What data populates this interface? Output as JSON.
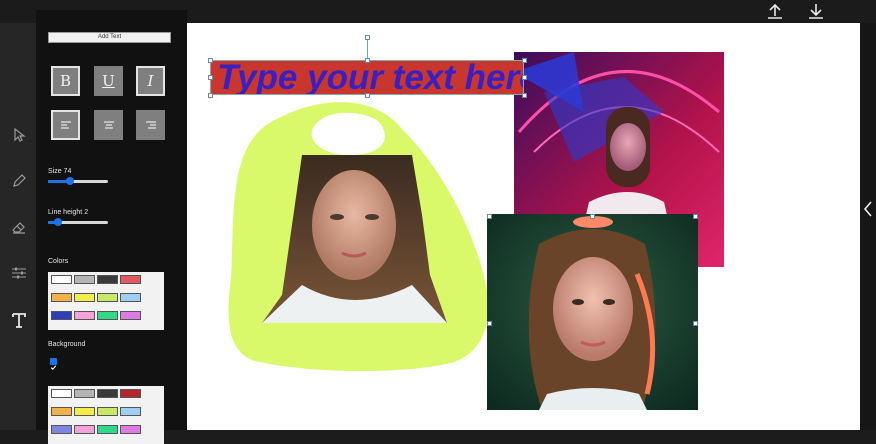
{
  "toolbar": {
    "upload_icon": "upload-icon",
    "download_icon": "download-icon"
  },
  "tools": [
    "select-tool",
    "pen-tool",
    "eraser-tool",
    "adjust-tool",
    "text-tool"
  ],
  "panel": {
    "add_text_label": "Add Text",
    "format_buttons": {
      "bold": "B",
      "underline": "U",
      "italic": "I"
    },
    "size_label": "Size 74",
    "size_value": 74,
    "line_height_label": "Line height 2",
    "line_height_value": 2,
    "colors_label": "Colors",
    "background_label": "Background",
    "background_checked": true,
    "palette": [
      "#ffffff",
      "#b4b4b4",
      "#3a3a3a",
      "#e05a5f",
      "#f2b24a",
      "#f2ed4a",
      "#c9e86a",
      "#9ecff0",
      "#2d3fb8",
      "#f2a4d8",
      "#2fd98a",
      "#dd7be0"
    ],
    "bg_palette": [
      "#ffffff",
      "#b4b4b4",
      "#3a3a3a",
      "#b2272d",
      "#f2b24a",
      "#f2ed4a",
      "#c9e86a",
      "#9ecff0",
      "#7f86e0",
      "#f2a4d8",
      "#2fd98a",
      "#dd7be0"
    ]
  },
  "canvas": {
    "text_content": "Type your text here",
    "text_color": "#3a1fc2",
    "text_bg_color": "#c8362e",
    "highlight_color": "#d9f86a"
  }
}
